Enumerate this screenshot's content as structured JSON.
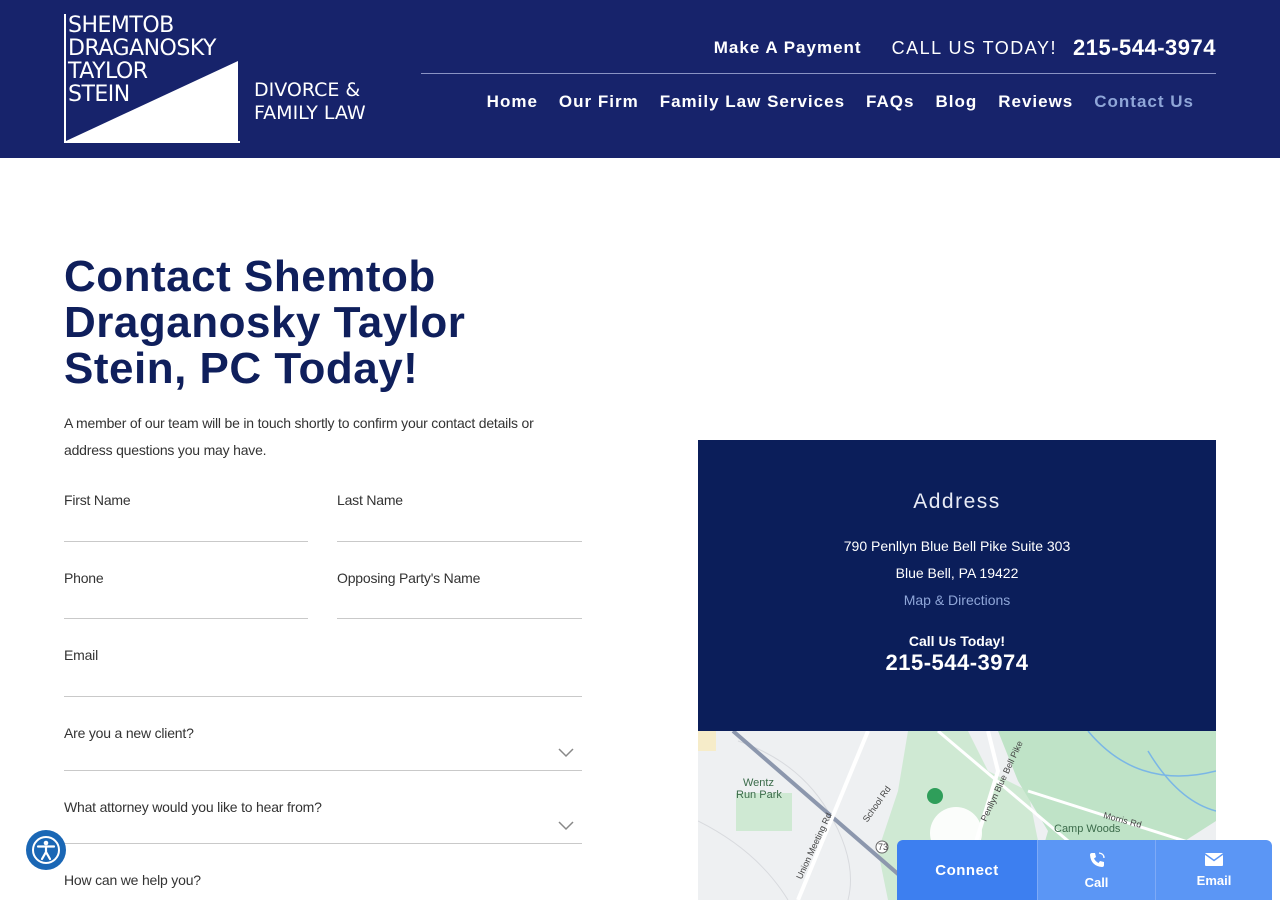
{
  "header": {
    "logo": {
      "name_lines": [
        "SHEMTOB",
        "DRAGANOSKY",
        "TAYLOR",
        "STEIN"
      ],
      "sub_lines": [
        "DIVORCE &",
        "FAMILY LAW"
      ]
    },
    "make_payment": "Make A Payment",
    "call_us": "CALL US TODAY!",
    "phone": "215-544-3974",
    "nav": [
      "Home",
      "Our Firm",
      "Family Law Services",
      "FAQs",
      "Blog",
      "Reviews",
      "Contact Us"
    ]
  },
  "main": {
    "title": "Contact Shemtob Draganosky Taylor Stein, PC Today!",
    "intro": "A member of our team will be in touch shortly to confirm your contact details or address questions you may have."
  },
  "form": {
    "first_name": "First Name",
    "last_name": "Last Name",
    "phone": "Phone",
    "opposing_party": "Opposing Party's Name",
    "email": "Email",
    "new_client": "Are you a new client?",
    "attorney": "What attorney would you like to hear from?",
    "help": "How can we help you?"
  },
  "address": {
    "title": "Address",
    "line1": "790 Penllyn Blue Bell Pike Suite 303",
    "line2": "Blue Bell, PA 19422",
    "map_link": "Map & Directions",
    "call_label": "Call Us Today!",
    "phone": "215-544-3974"
  },
  "map": {
    "labels": [
      "Wentz",
      "Run Park",
      "School Rd",
      "Union Meeting Rd",
      "Penllyn Blue Bell Pike",
      "Morris Rd",
      "Camp Woods",
      "73"
    ]
  },
  "connect": {
    "main": "Connect",
    "call": "Call",
    "email": "Email"
  },
  "colors": {
    "header_bg": "#17236b",
    "panel_bg": "#0b1e5a",
    "title": "#0f1f5c",
    "link": "#8fa6d8",
    "connect": "#3d7ff0"
  }
}
